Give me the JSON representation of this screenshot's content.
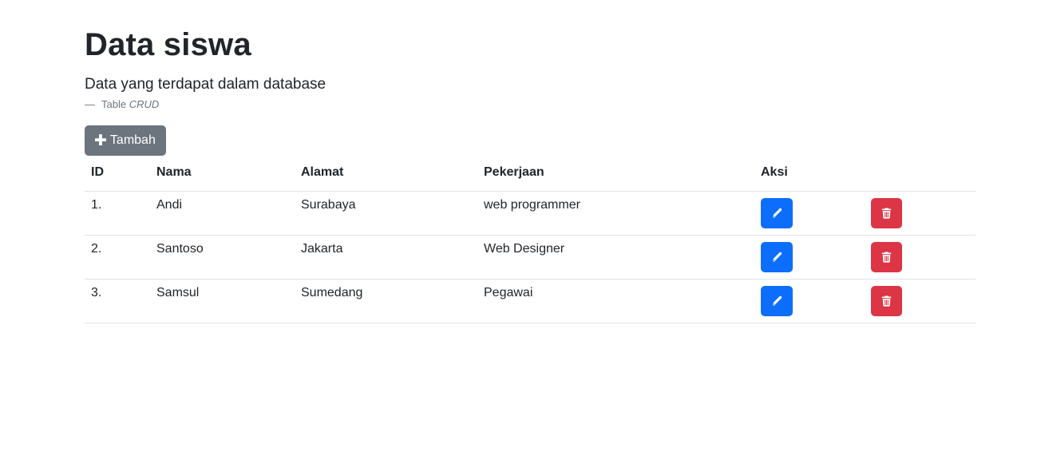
{
  "header": {
    "title": "Data siswa",
    "lead": "Data yang terdapat dalam database",
    "caption_dash": "—",
    "caption_prefix": "Table",
    "caption_emph": "CRUD"
  },
  "toolbar": {
    "add_icon": "plus-icon",
    "add_label": "Tambah"
  },
  "table": {
    "columns": [
      "ID",
      "Nama",
      "Alamat",
      "Pekerjaan",
      "Aksi"
    ],
    "rows": [
      {
        "id": "1.",
        "nama": "Andi",
        "alamat": "Surabaya",
        "pekerjaan": "web programmer"
      },
      {
        "id": "2.",
        "nama": "Santoso",
        "alamat": "Jakarta",
        "pekerjaan": "Web Designer"
      },
      {
        "id": "3.",
        "nama": "Samsul",
        "alamat": "Sumedang",
        "pekerjaan": "Pegawai"
      }
    ],
    "edit_icon": "pencil-icon",
    "delete_icon": "trash-icon"
  },
  "colors": {
    "secondary": "#6c757d",
    "primary": "#0d6efd",
    "danger": "#dc3545",
    "border": "#dee2e6"
  }
}
